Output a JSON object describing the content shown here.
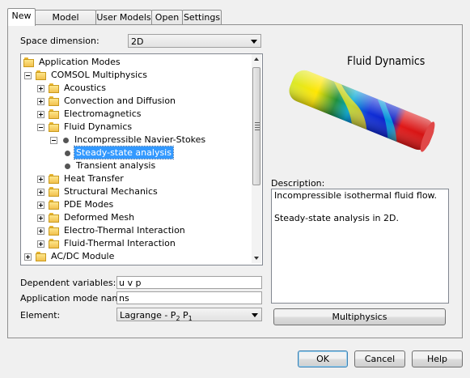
{
  "tabs": [
    "New",
    "Model Library",
    "User Models",
    "Open",
    "Settings"
  ],
  "space_dimension": {
    "label": "Space dimension:",
    "value": "2D"
  },
  "tree": {
    "items": [
      {
        "label": "Application Modes",
        "type": "folder",
        "expander": "none",
        "selected": false
      },
      {
        "label": "COMSOL Multiphysics",
        "type": "folder",
        "expander": "minus",
        "selected": false
      },
      {
        "label": "Acoustics",
        "type": "folder",
        "expander": "plus",
        "selected": false
      },
      {
        "label": "Convection and Diffusion",
        "type": "folder",
        "expander": "plus",
        "selected": false
      },
      {
        "label": "Electromagnetics",
        "type": "folder",
        "expander": "plus",
        "selected": false
      },
      {
        "label": "Fluid Dynamics",
        "type": "folder",
        "expander": "minus",
        "selected": false
      },
      {
        "label": "Incompressible Navier-Stokes",
        "type": "node",
        "expander": "minus",
        "selected": false
      },
      {
        "label": "Steady-state analysis",
        "type": "leaf",
        "expander": "none",
        "selected": true
      },
      {
        "label": "Transient analysis",
        "type": "leaf",
        "expander": "none",
        "selected": false
      },
      {
        "label": "Heat Transfer",
        "type": "folder",
        "expander": "plus",
        "selected": false
      },
      {
        "label": "Structural Mechanics",
        "type": "folder",
        "expander": "plus",
        "selected": false
      },
      {
        "label": "PDE Modes",
        "type": "folder",
        "expander": "plus",
        "selected": false
      },
      {
        "label": "Deformed Mesh",
        "type": "folder",
        "expander": "plus",
        "selected": false
      },
      {
        "label": "Electro-Thermal Interaction",
        "type": "folder",
        "expander": "plus",
        "selected": false
      },
      {
        "label": "Fluid-Thermal Interaction",
        "type": "folder",
        "expander": "plus",
        "selected": false
      },
      {
        "label": "AC/DC Module",
        "type": "folder",
        "expander": "plus",
        "selected": false
      }
    ]
  },
  "preview": {
    "title": "Fluid Dynamics"
  },
  "description": {
    "label": "Description:",
    "line1": "Incompressible isothermal fluid flow.",
    "line2": "Steady-state analysis in 2D."
  },
  "dependent_variables": {
    "label": "Dependent variables:",
    "value": "u v p"
  },
  "application_mode_name": {
    "label": "Application mode name:",
    "value": "ns"
  },
  "element": {
    "label": "Element:",
    "value_prefix": "Lagrange - P",
    "sub1": "2",
    "mid": " P",
    "sub2": "1"
  },
  "buttons": {
    "multiphysics": "Multiphysics",
    "ok": "OK",
    "cancel": "Cancel",
    "help": "Help"
  },
  "colors": {
    "selection": "#3399ff",
    "selection_border": "#1c5ba4"
  }
}
